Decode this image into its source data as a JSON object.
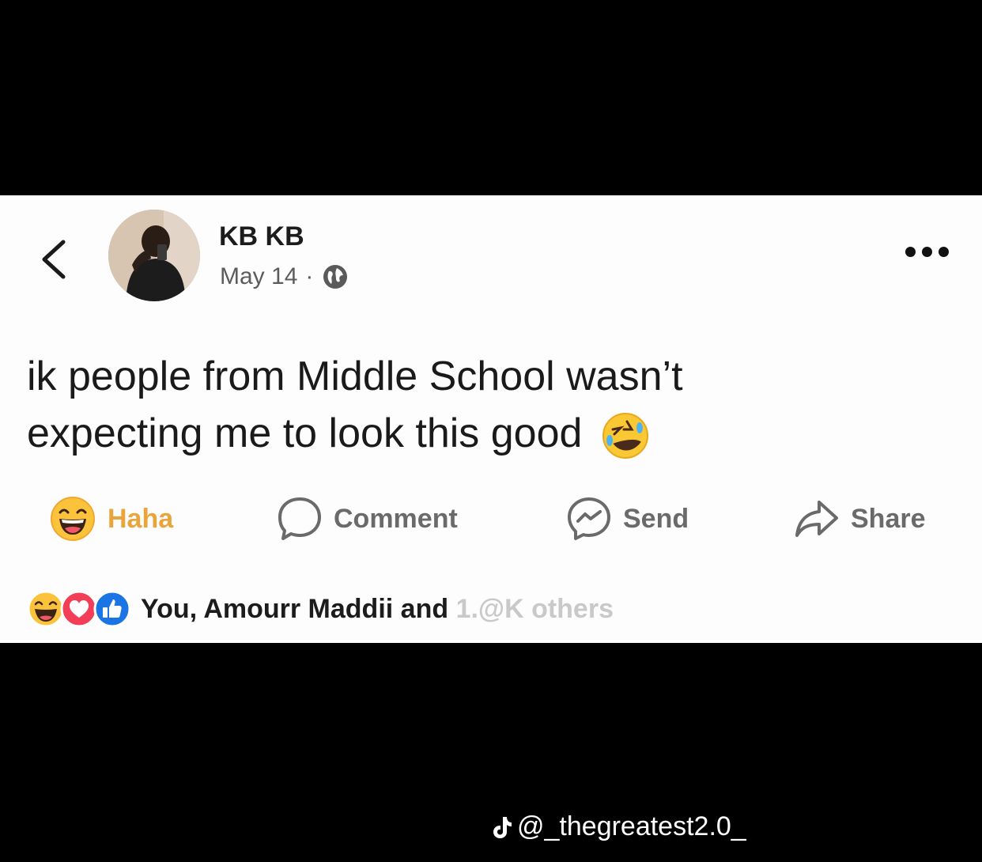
{
  "post": {
    "author": "KB KB",
    "date": "May 14",
    "separator": "·",
    "text_line1": "ik people from Middle School wasn’t",
    "text_line2": "expecting me to look this good"
  },
  "actions": {
    "haha": "Haha",
    "comment": "Comment",
    "send": "Send",
    "share": "Share"
  },
  "reactions": {
    "summary_visible": "You, Amourr Maddii and ",
    "summary_obscured": "1.@K others"
  },
  "watermark": {
    "handle": "@_thegreatest2.0_"
  },
  "icons": [
    "back-chevron-icon",
    "globe-icon",
    "more-options-icon",
    "laughing-emoji-icon",
    "haha-reaction-icon",
    "comment-bubble-icon",
    "messenger-icon",
    "share-arrow-icon",
    "heart-reaction-icon",
    "like-reaction-icon",
    "tiktok-logo-icon"
  ],
  "colors": {
    "haha_accent": "#e9a53a",
    "like_blue": "#1b74e4",
    "love_red": "#f33e58",
    "background": "#000000",
    "card": "#fdfdfd"
  }
}
